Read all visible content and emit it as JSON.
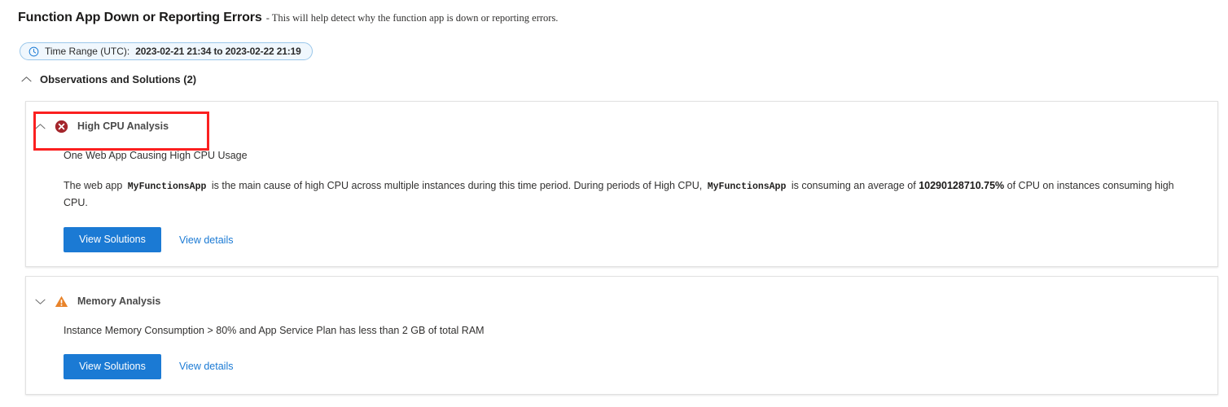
{
  "header": {
    "title": "Function App Down or Reporting Errors",
    "separator": "-",
    "subtitle": "This will help detect why the function app is down or reporting errors."
  },
  "time_range": {
    "icon": "clock-icon",
    "label": "Time Range (UTC):",
    "value": "2023-02-21 21:34 to 2023-02-22 21:19"
  },
  "section": {
    "chevron_icon": "chevron-up-icon",
    "title": "Observations and Solutions (2)",
    "count": 2,
    "expanded": true
  },
  "colors": {
    "primary_button": "#1b7ad4",
    "link": "#1b7ad4",
    "error_icon": "#a4262c",
    "warning_icon": "#e8832a",
    "annotation_box": "#fb2020",
    "pill_border": "#9ac7ea",
    "pill_background": "#f0f7fd",
    "card_border": "#e1e1e1"
  },
  "cards": [
    {
      "id": "high-cpu-analysis",
      "chevron_icon": "chevron-up-icon",
      "status_icon": "error-circle-x-icon",
      "status": "error",
      "title": "High CPU Analysis",
      "expanded": true,
      "highlighted": true,
      "summary": "One Web App Causing High CPU Usage",
      "detail": {
        "part1": "The web app",
        "app_name_1": "MyFunctionsApp",
        "part2": "is the main cause of high CPU across multiple instances during this time period. During periods of High CPU,",
        "app_name_2": "MyFunctionsApp",
        "part3": "is consuming an average of",
        "value": "10290128710.75%",
        "part4": "of CPU on instances consuming high CPU."
      },
      "primary_button": "View Solutions",
      "details_link": "View details"
    },
    {
      "id": "memory-analysis",
      "chevron_icon": "chevron-down-icon",
      "status_icon": "warning-triangle-icon",
      "status": "warning",
      "title": "Memory Analysis",
      "expanded": false,
      "highlighted": false,
      "summary": "Instance Memory Consumption > 80% and App Service Plan has less than 2 GB of total RAM",
      "primary_button": "View Solutions",
      "details_link": "View details"
    }
  ]
}
